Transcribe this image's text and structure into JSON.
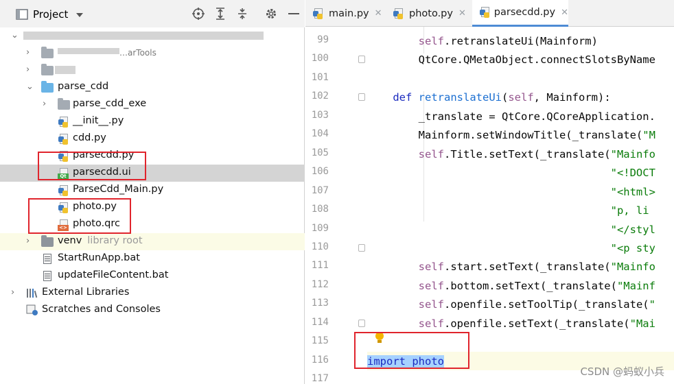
{
  "project_panel": {
    "title": "Project",
    "header_icons": [
      "crosshair-icon",
      "expand-all-icon",
      "collapse-all-icon",
      "gear-icon",
      "minimize-icon"
    ],
    "tree": [
      {
        "label": "",
        "type": "folder-blurred",
        "depth": 0,
        "expanded": true
      },
      {
        "label": "…arTools",
        "type": "folder",
        "depth": 1,
        "expanded": false
      },
      {
        "label": "",
        "type": "folder-blurred",
        "depth": 1,
        "expanded": false
      },
      {
        "label": "parse_cdd",
        "type": "folder-source",
        "depth": 1,
        "expanded": true
      },
      {
        "label": "parse_cdd_exe",
        "type": "folder",
        "depth": 2,
        "expanded": false
      },
      {
        "label": "__init__.py",
        "type": "python-file",
        "depth": 2
      },
      {
        "label": "cdd.py",
        "type": "python-file",
        "depth": 2
      },
      {
        "label": "parsecdd.py",
        "type": "python-file",
        "depth": 2
      },
      {
        "label": "parsecdd.ui",
        "type": "qt-ui-file",
        "depth": 2,
        "selected": true
      },
      {
        "label": "ParseCdd_Main.py",
        "type": "python-file",
        "depth": 2
      },
      {
        "label": "photo.py",
        "type": "python-file",
        "depth": 2
      },
      {
        "label": "photo.qrc",
        "type": "qrc-file",
        "depth": 2
      },
      {
        "label": "venv",
        "sublabel": "library root",
        "type": "folder",
        "depth": 1,
        "expanded": false,
        "highlighted": true
      },
      {
        "label": "StartRunApp.bat",
        "type": "bat-file",
        "depth": 1
      },
      {
        "label": "updateFileContent.bat",
        "type": "bat-file",
        "depth": 1
      },
      {
        "label": "External Libraries",
        "type": "libraries",
        "depth": 0,
        "expanded": false
      },
      {
        "label": "Scratches and Consoles",
        "type": "scratches",
        "depth": 0
      }
    ]
  },
  "editor": {
    "tabs": [
      {
        "label": "main.py",
        "active": false
      },
      {
        "label": "photo.py",
        "active": false
      },
      {
        "label": "parsecdd.py",
        "active": true
      }
    ],
    "lines": [
      {
        "num": "99",
        "code": [
          {
            "t": "        "
          },
          {
            "t": "self",
            "c": "slf"
          },
          {
            "t": ".retranslateUi(Mainform)"
          }
        ]
      },
      {
        "num": "100",
        "code": [
          {
            "t": "        QtCore.QMetaObject.connectSlotsByName"
          }
        ]
      },
      {
        "num": "101",
        "code": []
      },
      {
        "num": "102",
        "code": [
          {
            "t": "    "
          },
          {
            "t": "def",
            "c": "kw"
          },
          {
            "t": " "
          },
          {
            "t": "retranslateUi",
            "c": "fn"
          },
          {
            "t": "("
          },
          {
            "t": "self",
            "c": "slf"
          },
          {
            "t": ", Mainform):"
          }
        ]
      },
      {
        "num": "103",
        "code": [
          {
            "t": "        _translate = QtCore.QCoreApplication."
          }
        ]
      },
      {
        "num": "104",
        "code": [
          {
            "t": "        Mainform.setWindowTitle(_translate("
          },
          {
            "t": "\"M",
            "c": "str"
          }
        ]
      },
      {
        "num": "105",
        "code": [
          {
            "t": "        "
          },
          {
            "t": "self",
            "c": "slf"
          },
          {
            "t": ".Title.setText(_translate("
          },
          {
            "t": "\"Mainfo",
            "c": "str"
          }
        ]
      },
      {
        "num": "106",
        "code": [
          {
            "t": "                                      "
          },
          {
            "t": "\"<!DOCT",
            "c": "str"
          }
        ]
      },
      {
        "num": "107",
        "code": [
          {
            "t": "                                      "
          },
          {
            "t": "\"<html>",
            "c": "str"
          }
        ]
      },
      {
        "num": "108",
        "code": [
          {
            "t": "                                      "
          },
          {
            "t": "\"p, li",
            "c": "str"
          }
        ]
      },
      {
        "num": "109",
        "code": [
          {
            "t": "                                      "
          },
          {
            "t": "\"</styl",
            "c": "str"
          }
        ]
      },
      {
        "num": "110",
        "code": [
          {
            "t": "                                      "
          },
          {
            "t": "\"<p sty",
            "c": "str"
          }
        ]
      },
      {
        "num": "111",
        "code": [
          {
            "t": "        "
          },
          {
            "t": "self",
            "c": "slf"
          },
          {
            "t": ".start.setText(_translate("
          },
          {
            "t": "\"Mainfo",
            "c": "str"
          }
        ]
      },
      {
        "num": "112",
        "code": [
          {
            "t": "        "
          },
          {
            "t": "self",
            "c": "slf"
          },
          {
            "t": ".bottom.setText(_translate("
          },
          {
            "t": "\"Mainf",
            "c": "str"
          }
        ]
      },
      {
        "num": "113",
        "code": [
          {
            "t": "        "
          },
          {
            "t": "self",
            "c": "slf"
          },
          {
            "t": ".openfile.setToolTip(_translate("
          },
          {
            "t": "\"",
            "c": "str"
          }
        ]
      },
      {
        "num": "114",
        "code": [
          {
            "t": "        "
          },
          {
            "t": "self",
            "c": "slf"
          },
          {
            "t": ".openfile.setText(_translate("
          },
          {
            "t": "\"Mai",
            "c": "str"
          }
        ]
      },
      {
        "num": "115",
        "code": []
      },
      {
        "num": "116",
        "code": [
          {
            "t": "import photo",
            "c": "sel"
          }
        ],
        "caret": true
      },
      {
        "num": "117",
        "code": []
      }
    ]
  },
  "watermark": "CSDN @蚂蚁小兵",
  "colors": {
    "annotation_box": "#e0242c",
    "selection": "#a6d2ff",
    "tab_underline": "#4d8bd4"
  }
}
